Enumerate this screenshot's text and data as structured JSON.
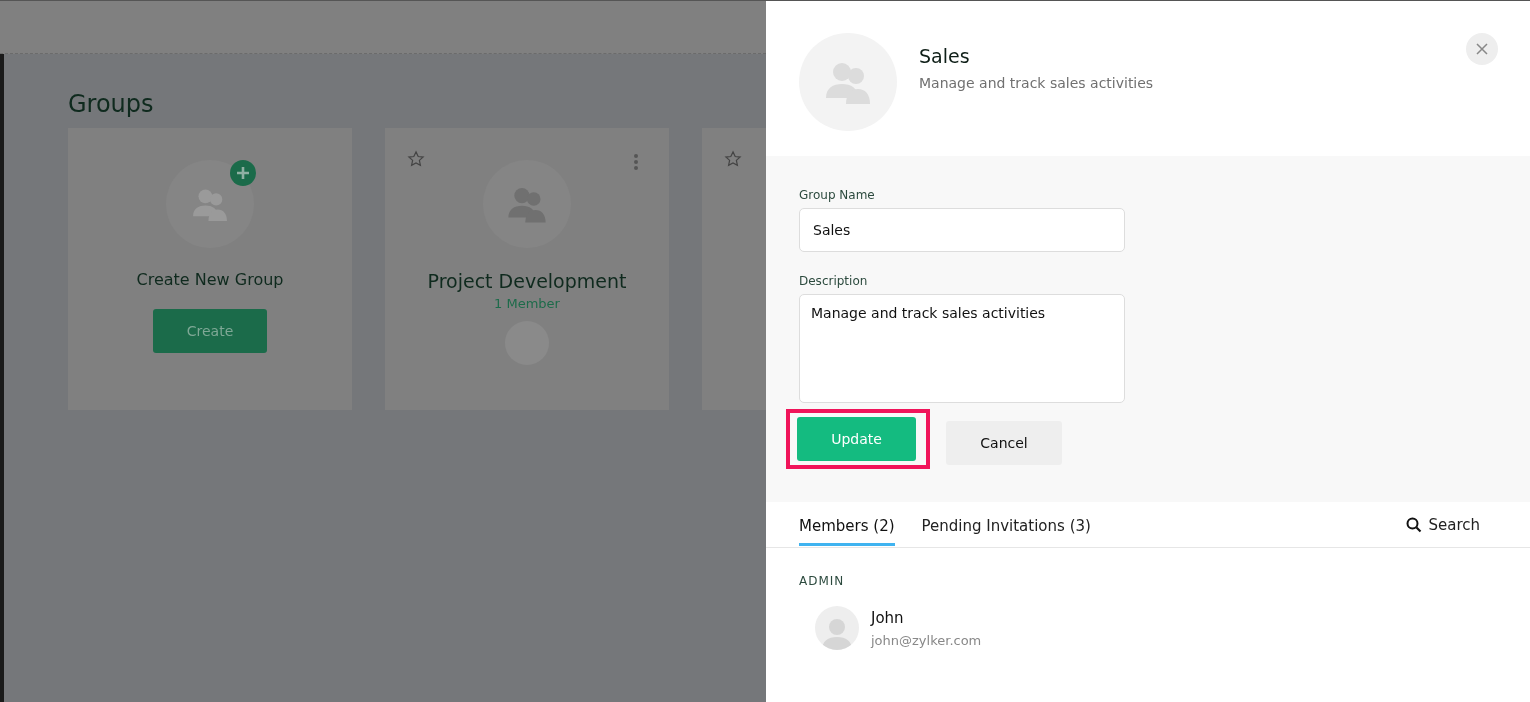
{
  "background": {
    "title": "Groups",
    "cards": [
      {
        "kind": "create",
        "name": "Create New Group",
        "button": "Create"
      },
      {
        "kind": "group",
        "name": "Project Development",
        "members": "1 Member"
      },
      {
        "kind": "partial"
      }
    ]
  },
  "panel": {
    "name": "Sales",
    "description": "Manage and track sales activities",
    "form": {
      "name_label": "Group Name",
      "name_value": "Sales",
      "description_label": "Description",
      "description_value": "Manage and track sales activities"
    },
    "buttons": [
      {
        "kind": "primary",
        "label": "Update",
        "highlighted": true
      },
      {
        "kind": "secondary",
        "label": "Cancel",
        "highlighted": false
      }
    ],
    "tabs": [
      {
        "label": "Members (2)",
        "selected": true
      },
      {
        "label": "Pending Invitations (3)",
        "selected": false
      }
    ],
    "search": "Search",
    "section": "ADMIN",
    "members": [
      {
        "name": "John",
        "email": "john@zylker.com"
      }
    ]
  }
}
